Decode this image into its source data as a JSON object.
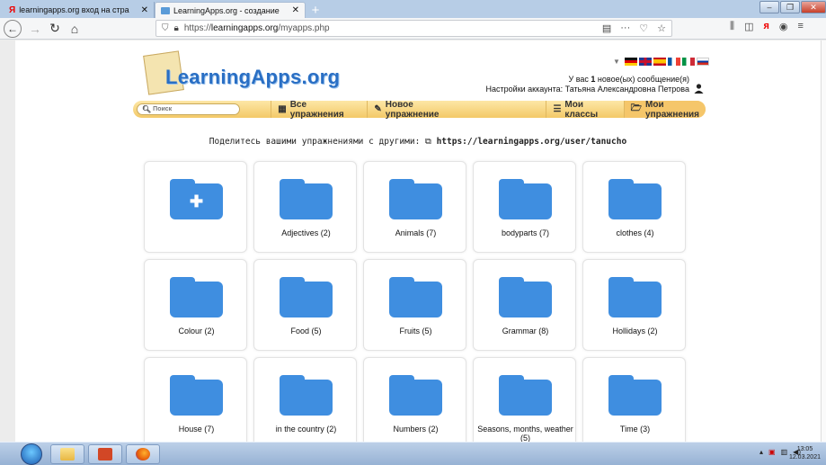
{
  "browser": {
    "tabs": [
      {
        "label": "learningapps.org вход на стра"
      },
      {
        "label": "LearningApps.org - создание"
      }
    ],
    "url_prefix": "https://",
    "url_domain": "learningapps.org",
    "url_path": "/myapps.php",
    "url_more": "···"
  },
  "header": {
    "logo_text": "LearningApps.org",
    "message_line1_prefix": "У вас ",
    "message_count": "1",
    "message_line1_suffix": " новое(ых) сообщение(я)",
    "message_line2": "Настройки аккаунта: Татьяна Александровна Петрова"
  },
  "flags": [
    {
      "name": "german",
      "colors": [
        "#111",
        "#d00",
        "#fc0"
      ]
    },
    {
      "name": "english",
      "colors": [
        "#1f3a93",
        "#fff",
        "#c8102e"
      ]
    },
    {
      "name": "spanish",
      "colors": [
        "#c60b1e",
        "#ffc400",
        "#c60b1e"
      ]
    },
    {
      "name": "french",
      "colors": [
        "#0055a4",
        "#fff",
        "#ef4135"
      ]
    },
    {
      "name": "italian",
      "colors": [
        "#009246",
        "#fff",
        "#ce2b37"
      ]
    },
    {
      "name": "russian",
      "colors": [
        "#fff",
        "#0039a6",
        "#d52b1e"
      ]
    }
  ],
  "menu": {
    "search_placeholder": "Поиск",
    "all_exercises": "Все упражнения",
    "new_exercise": "Новое упражнение",
    "my_classes": "Мои классы",
    "my_exercises": "Мои упражнения"
  },
  "share": {
    "label": "Поделитесь вашими упражнениями с другими:",
    "link": "https://learningapps.org/user/tanucho"
  },
  "folders": [
    {
      "label": ""
    },
    {
      "label": "Adjectives (2)"
    },
    {
      "label": "Animals (7)"
    },
    {
      "label": "bodyparts (7)"
    },
    {
      "label": "clothes (4)"
    },
    {
      "label": "Colour (2)"
    },
    {
      "label": "Food (5)"
    },
    {
      "label": "Fruits (5)"
    },
    {
      "label": "Grammar (8)"
    },
    {
      "label": "Hollidays (2)"
    },
    {
      "label": "House (7)"
    },
    {
      "label": "in the country (2)"
    },
    {
      "label": "Numbers (2)"
    },
    {
      "label": "Seasons, months, weather (5)"
    },
    {
      "label": "Time (3)"
    }
  ],
  "taskbar": {
    "time": "13:05",
    "date": "12.03.2021"
  },
  "colors": {
    "folder": "#3f8ee0",
    "menu_bar": "#f3c968",
    "logo": "#2a6fc4"
  }
}
